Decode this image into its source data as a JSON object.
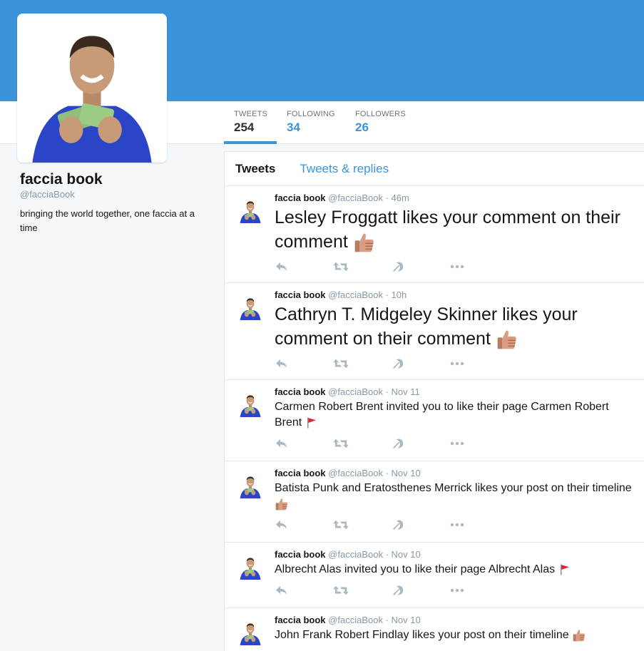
{
  "profile": {
    "name": "faccia book",
    "handle": "@facciaBook",
    "bio": "bringing the world together, one faccia at a time"
  },
  "stats": [
    {
      "label": "TWEETS",
      "value": "254"
    },
    {
      "label": "FOLLOWING",
      "value": "34"
    },
    {
      "label": "FOLLOWERS",
      "value": "26"
    }
  ],
  "tabs": {
    "tweets": "Tweets",
    "replies": "Tweets & replies"
  },
  "tweets": [
    {
      "name": "faccia book",
      "handle": "@facciaBook",
      "time": "· 46m",
      "text": "Lesley Froggatt likes your comment on their comment",
      "emoji": "thumbs-up-icon"
    },
    {
      "name": "faccia book",
      "handle": "@facciaBook",
      "time": "· 10h",
      "text": "Cathryn T. Midgeley Skinner likes your comment on their comment",
      "emoji": "thumbs-up-icon"
    },
    {
      "name": "faccia book",
      "handle": "@facciaBook",
      "time": "· Nov 11",
      "text": "Carmen Robert Brent invited you to like their page Carmen Robert Brent",
      "emoji": "red-flag-icon"
    },
    {
      "name": "faccia book",
      "handle": "@facciaBook",
      "time": "· Nov 10",
      "text": "Batista Punk and Eratosthenes Merrick likes your post on their timeline",
      "emoji": "thumbs-up-icon"
    },
    {
      "name": "faccia book",
      "handle": "@facciaBook",
      "time": "· Nov 10",
      "text": "Albrecht Alas invited you to like their page Albrecht Alas",
      "emoji": "red-flag-icon"
    },
    {
      "name": "faccia book",
      "handle": "@facciaBook",
      "time": "· Nov 10",
      "text": "John Frank Robert Findlay likes your post on their timeline",
      "emoji": "thumbs-up-icon"
    }
  ],
  "colors": {
    "banner": "#3b94d9",
    "accent": "#3b94d9",
    "muted": "#8899a6",
    "icon": "#aab8c2"
  }
}
